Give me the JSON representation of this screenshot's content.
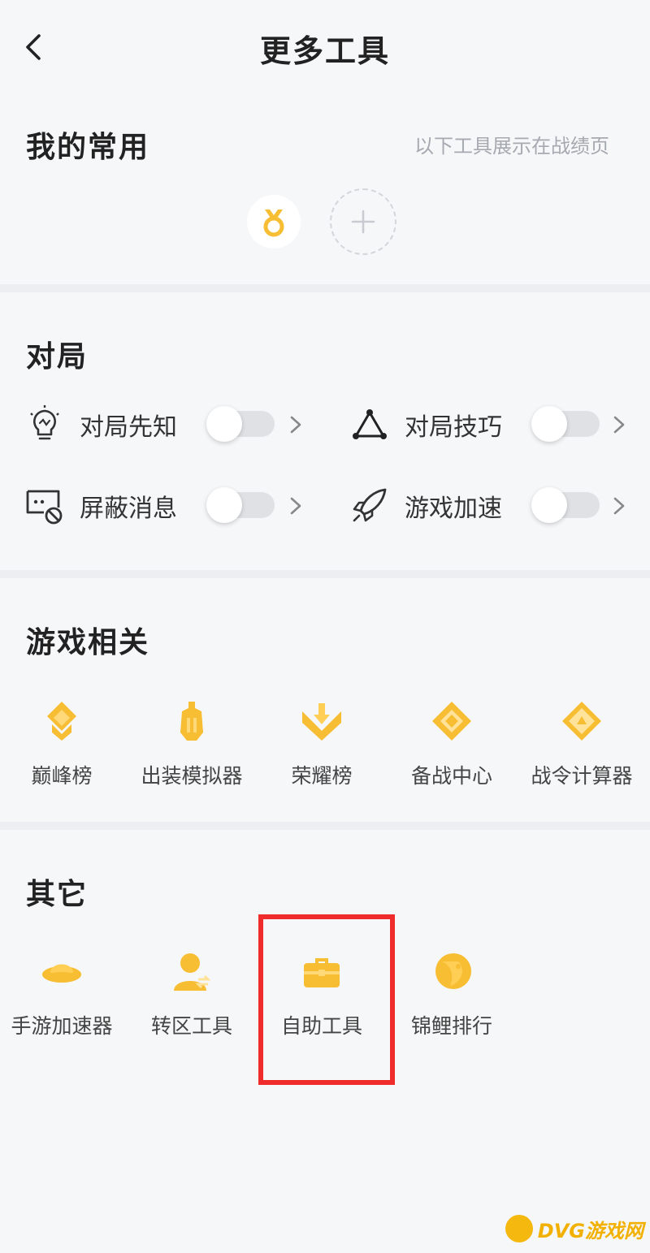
{
  "header": {
    "title": "更多工具",
    "back_icon": "back-icon"
  },
  "favorites": {
    "title": "我的常用",
    "hint": "以下工具展示在战绩页",
    "items": [
      {
        "icon": "medal-icon"
      }
    ],
    "add_icon": "plus-icon"
  },
  "match": {
    "title": "对局",
    "options": [
      {
        "label": "对局先知",
        "icon": "lightbulb-icon",
        "enabled": false
      },
      {
        "label": "对局技巧",
        "icon": "triangle-nodes-icon",
        "enabled": false
      },
      {
        "label": "屏蔽消息",
        "icon": "block-message-icon",
        "enabled": false
      },
      {
        "label": "游戏加速",
        "icon": "rocket-icon",
        "enabled": false
      }
    ]
  },
  "game": {
    "title": "游戏相关",
    "items": [
      {
        "label": "巅峰榜",
        "icon": "peak-rank-icon"
      },
      {
        "label": "出装模拟器",
        "icon": "equipment-simulator-icon"
      },
      {
        "label": "荣耀榜",
        "icon": "honor-rank-icon"
      },
      {
        "label": "备战中心",
        "icon": "prep-center-icon"
      },
      {
        "label": "战令计算器",
        "icon": "battle-pass-calculator-icon"
      }
    ]
  },
  "other": {
    "title": "其它",
    "items": [
      {
        "label": "手游加速器",
        "icon": "ufo-accelerator-icon"
      },
      {
        "label": "转区工具",
        "icon": "transfer-user-icon"
      },
      {
        "label": "自助工具",
        "icon": "toolbox-icon"
      },
      {
        "label": "锦鲤排行",
        "icon": "koi-icon"
      }
    ]
  },
  "colors": {
    "accent": "#f7bd33",
    "highlight": "#ef2b2b",
    "toggle_off": "#dfe1e4"
  },
  "watermark": {
    "text": "DVG游戏网"
  }
}
